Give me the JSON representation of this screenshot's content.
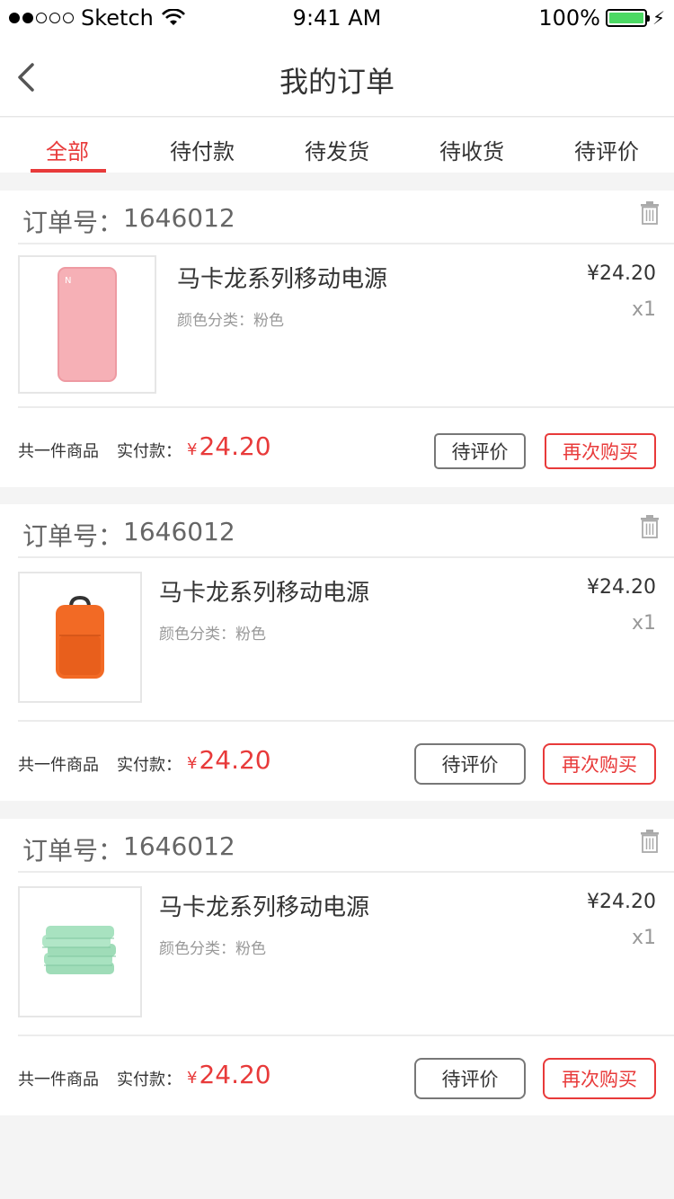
{
  "status_bar": {
    "carrier": "Sketch",
    "time": "9:41 AM",
    "battery": "100%"
  },
  "nav": {
    "title": "我的订单"
  },
  "tabs": [
    {
      "label": "全部",
      "active": true
    },
    {
      "label": "待付款",
      "active": false
    },
    {
      "label": "待发货",
      "active": false
    },
    {
      "label": "待收货",
      "active": false
    },
    {
      "label": "待评价",
      "active": false
    }
  ],
  "orders": [
    {
      "order_no_label": "订单号：",
      "order_no": "1646012",
      "product_name": "马卡龙系列移动电源",
      "spec_label": "颜色分类：",
      "spec_value": "粉色",
      "price": "¥24.20",
      "qty": "x1",
      "item_count": "共一件商品",
      "paid_label": "实付款：",
      "currency": "¥",
      "paid_amount": "24.20",
      "review_btn": "待评价",
      "rebuy_btn": "再次购买",
      "thumb_icon": "pink-power-bank"
    },
    {
      "order_no_label": "订单号：",
      "order_no": "1646012",
      "product_name": "马卡龙系列移动电源",
      "spec_label": "颜色分类：",
      "spec_value": "粉色",
      "price": "¥24.20",
      "qty": "x1",
      "item_count": "共一件商品",
      "paid_label": "实付款：",
      "currency": "¥",
      "paid_amount": "24.20",
      "review_btn": "待评价",
      "rebuy_btn": "再次购买",
      "thumb_icon": "orange-backpack"
    },
    {
      "order_no_label": "订单号：",
      "order_no": "1646012",
      "product_name": "马卡龙系列移动电源",
      "spec_label": "颜色分类：",
      "spec_value": "粉色",
      "price": "¥24.20",
      "qty": "x1",
      "item_count": "共一件商品",
      "paid_label": "实付款：",
      "currency": "¥",
      "paid_amount": "24.20",
      "review_btn": "待评价",
      "rebuy_btn": "再次购买",
      "thumb_icon": "green-wipes-pack"
    }
  ],
  "colors": {
    "accent": "#e83a3a",
    "battery": "#4cd964",
    "background": "#f4f4f4"
  }
}
